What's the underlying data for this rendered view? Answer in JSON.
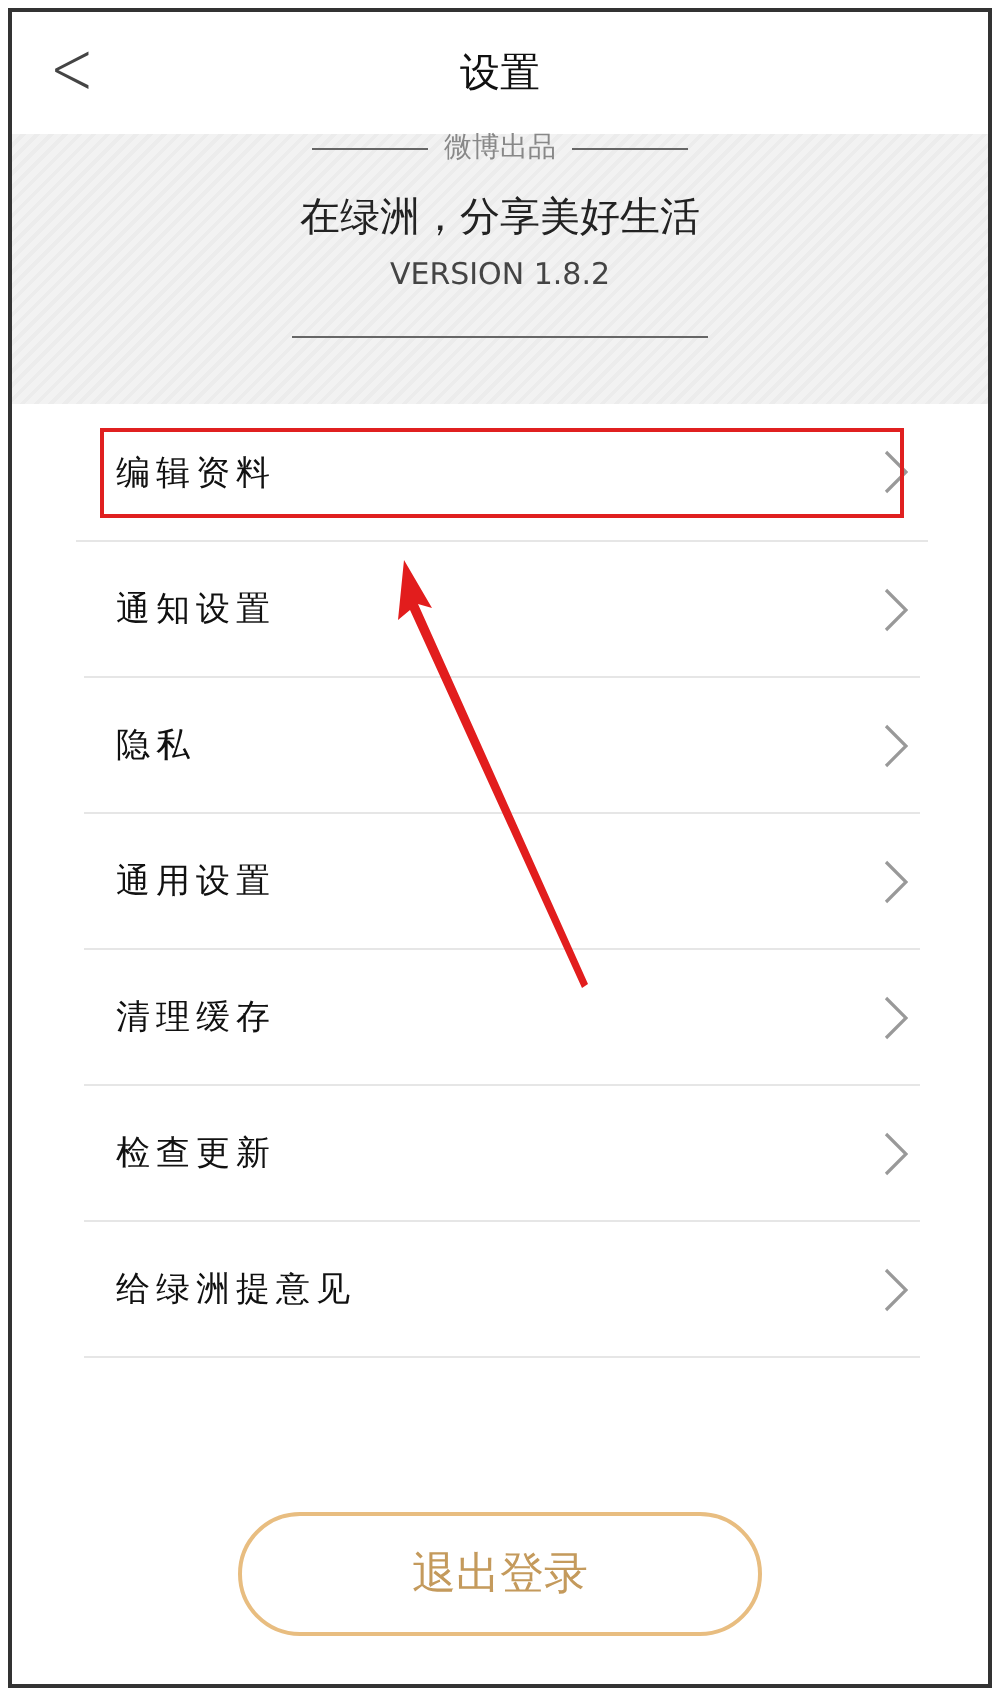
{
  "header": {
    "back": "<",
    "title": "设置"
  },
  "banner": {
    "maker": "微博出品",
    "slogan": "在绿洲，分享美好生活",
    "version": "VERSION 1.8.2"
  },
  "items": [
    {
      "label": "编辑资料",
      "highlighted": true
    },
    {
      "label": "通知设置",
      "highlighted": false
    },
    {
      "label": "隐私",
      "highlighted": false
    },
    {
      "label": "通用设置",
      "highlighted": false
    },
    {
      "label": "清理缓存",
      "highlighted": false
    },
    {
      "label": "检查更新",
      "highlighted": false
    },
    {
      "label": "给绿洲提意见",
      "highlighted": false
    }
  ],
  "logout": "退出登录"
}
